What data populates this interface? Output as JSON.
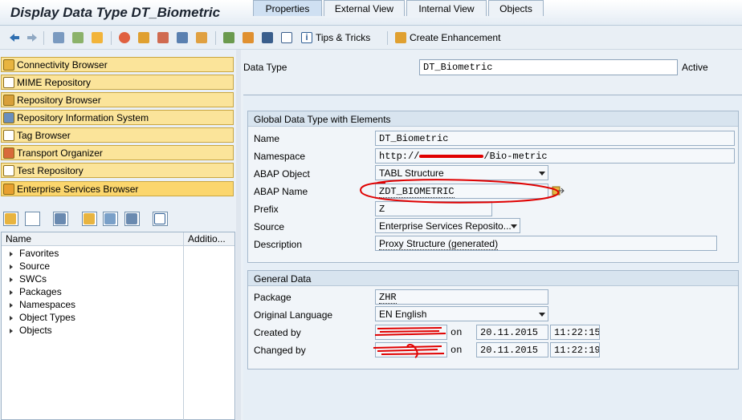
{
  "window": {
    "title": "Display Data Type DT_Biometric"
  },
  "toolbar": {
    "tips_label": "Tips & Tricks",
    "enhancement_label": "Create Enhancement"
  },
  "left": {
    "buttons": [
      {
        "label": "Connectivity Browser",
        "icon": "connectivity-icon"
      },
      {
        "label": "MIME Repository",
        "icon": "mime-icon"
      },
      {
        "label": "Repository Browser",
        "icon": "repository-icon"
      },
      {
        "label": "Repository Information System",
        "icon": "info-system-icon"
      },
      {
        "label": "Tag Browser",
        "icon": "tag-icon"
      },
      {
        "label": "Transport Organizer",
        "icon": "transport-icon"
      },
      {
        "label": "Test Repository",
        "icon": "test-icon"
      },
      {
        "label": "Enterprise Services Browser",
        "icon": "enterprise-icon"
      }
    ],
    "tree_header": {
      "name": "Name",
      "addition": "Additio..."
    },
    "tree_nodes": [
      "Favorites",
      "Source",
      "SWCs",
      "Packages",
      "Namespaces",
      "Object Types",
      "Objects"
    ]
  },
  "header": {
    "data_type_label": "Data Type",
    "data_type_value": "DT_Biometric",
    "status": "Active"
  },
  "tabs": [
    "Properties",
    "External View",
    "Internal View",
    "Objects"
  ],
  "global_group": {
    "title": "Global Data Type with Elements",
    "name_label": "Name",
    "name_value": "DT_Biometric",
    "namespace_label": "Namespace",
    "namespace_value": "http://",
    "namespace_suffix": "/Bio-metric",
    "abap_object_label": "ABAP Object",
    "abap_object_value": "TABL Structure",
    "abap_name_label": "ABAP Name",
    "abap_name_value": "ZDT_BIOMETRIC",
    "prefix_label": "Prefix",
    "prefix_value": "Z",
    "source_label": "Source",
    "source_value": "Enterprise Services Reposito...",
    "description_label": "Description",
    "description_value": "Proxy Structure (generated)"
  },
  "general_group": {
    "title": "General Data",
    "package_label": "Package",
    "package_value": "ZHR",
    "language_label": "Original Language",
    "language_value": "EN English",
    "created_label": "Created by",
    "created_on_label": "on",
    "created_date": "20.11.2015",
    "created_time": "11:22:15",
    "changed_label": "Changed by",
    "changed_on_label": "on",
    "changed_date": "20.11.2015",
    "changed_time": "11:22:19"
  },
  "colors": {
    "accent": "#fbe49a",
    "panel": "#e6eef6",
    "annotation": "#e00000"
  }
}
